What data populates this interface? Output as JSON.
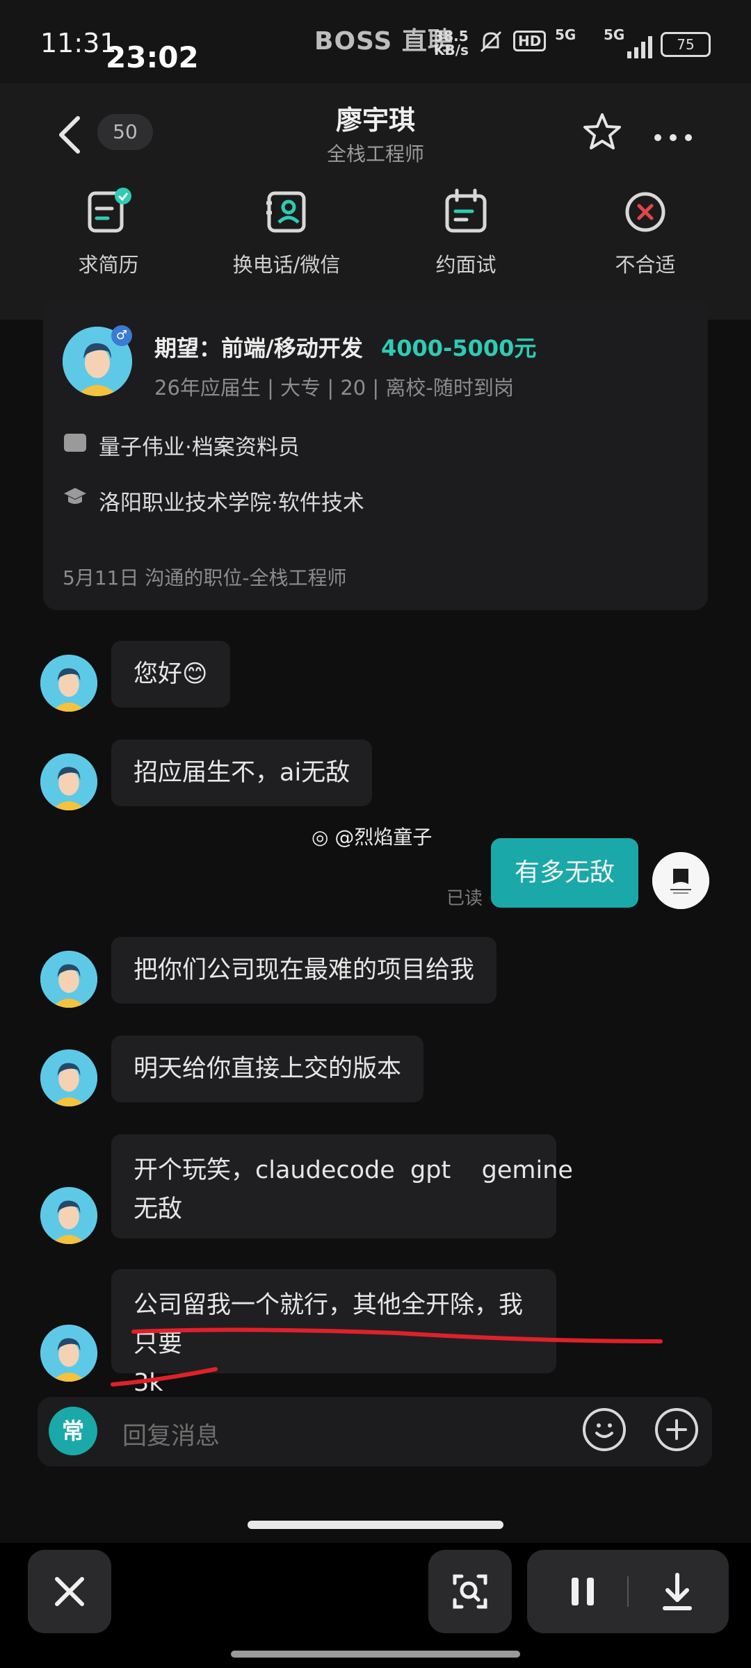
{
  "status_bar": {
    "time_overlay": "11:31",
    "time": "23:02",
    "app_name": "BOSS 直聘",
    "net_speed_value": "38.5",
    "net_speed_unit": "KB/s",
    "hd_label": "HD",
    "signal_1": "5G",
    "signal_2": "5G",
    "battery": "75"
  },
  "header": {
    "unread_count": "50",
    "contact_name": "廖宇琪",
    "contact_subtitle": "全栈工程师",
    "actions": [
      {
        "label": "求简历"
      },
      {
        "label": "换电话/微信"
      },
      {
        "label": "约面试"
      },
      {
        "label": "不合适"
      }
    ]
  },
  "profile": {
    "expectation": "期望：前端/移动开发",
    "salary": "4000-5000元",
    "meta": "26年应届生 | 大专 | 20 | 离校-随时到岗",
    "work": "量子伟业·档案资料员",
    "education": "洛阳职业技术学院·软件技术",
    "communicated": "5月11日 沟通的职位-全栈工程师"
  },
  "messages": [
    {
      "text": "您好😊"
    },
    {
      "text": "招应届生不，ai无敌"
    },
    {
      "text": "有多无敌",
      "status": "已读"
    },
    {
      "text": "把你们公司现在最难的项目给我"
    },
    {
      "text": "明天给你直接上交的版本"
    },
    {
      "line1": "开个玩笑，claudecode  gpt    gemine",
      "line2": "无敌"
    },
    {
      "line1": "公司留我一个就行，其他全开除，我只要",
      "line2": "3k"
    }
  ],
  "watermark": "@烈焰童子",
  "input": {
    "quick_label": "常",
    "placeholder": "回复消息"
  },
  "colors": {
    "accent": "#1aa9a8",
    "salary": "#2fcbb5",
    "annotation": "#e0202a"
  }
}
